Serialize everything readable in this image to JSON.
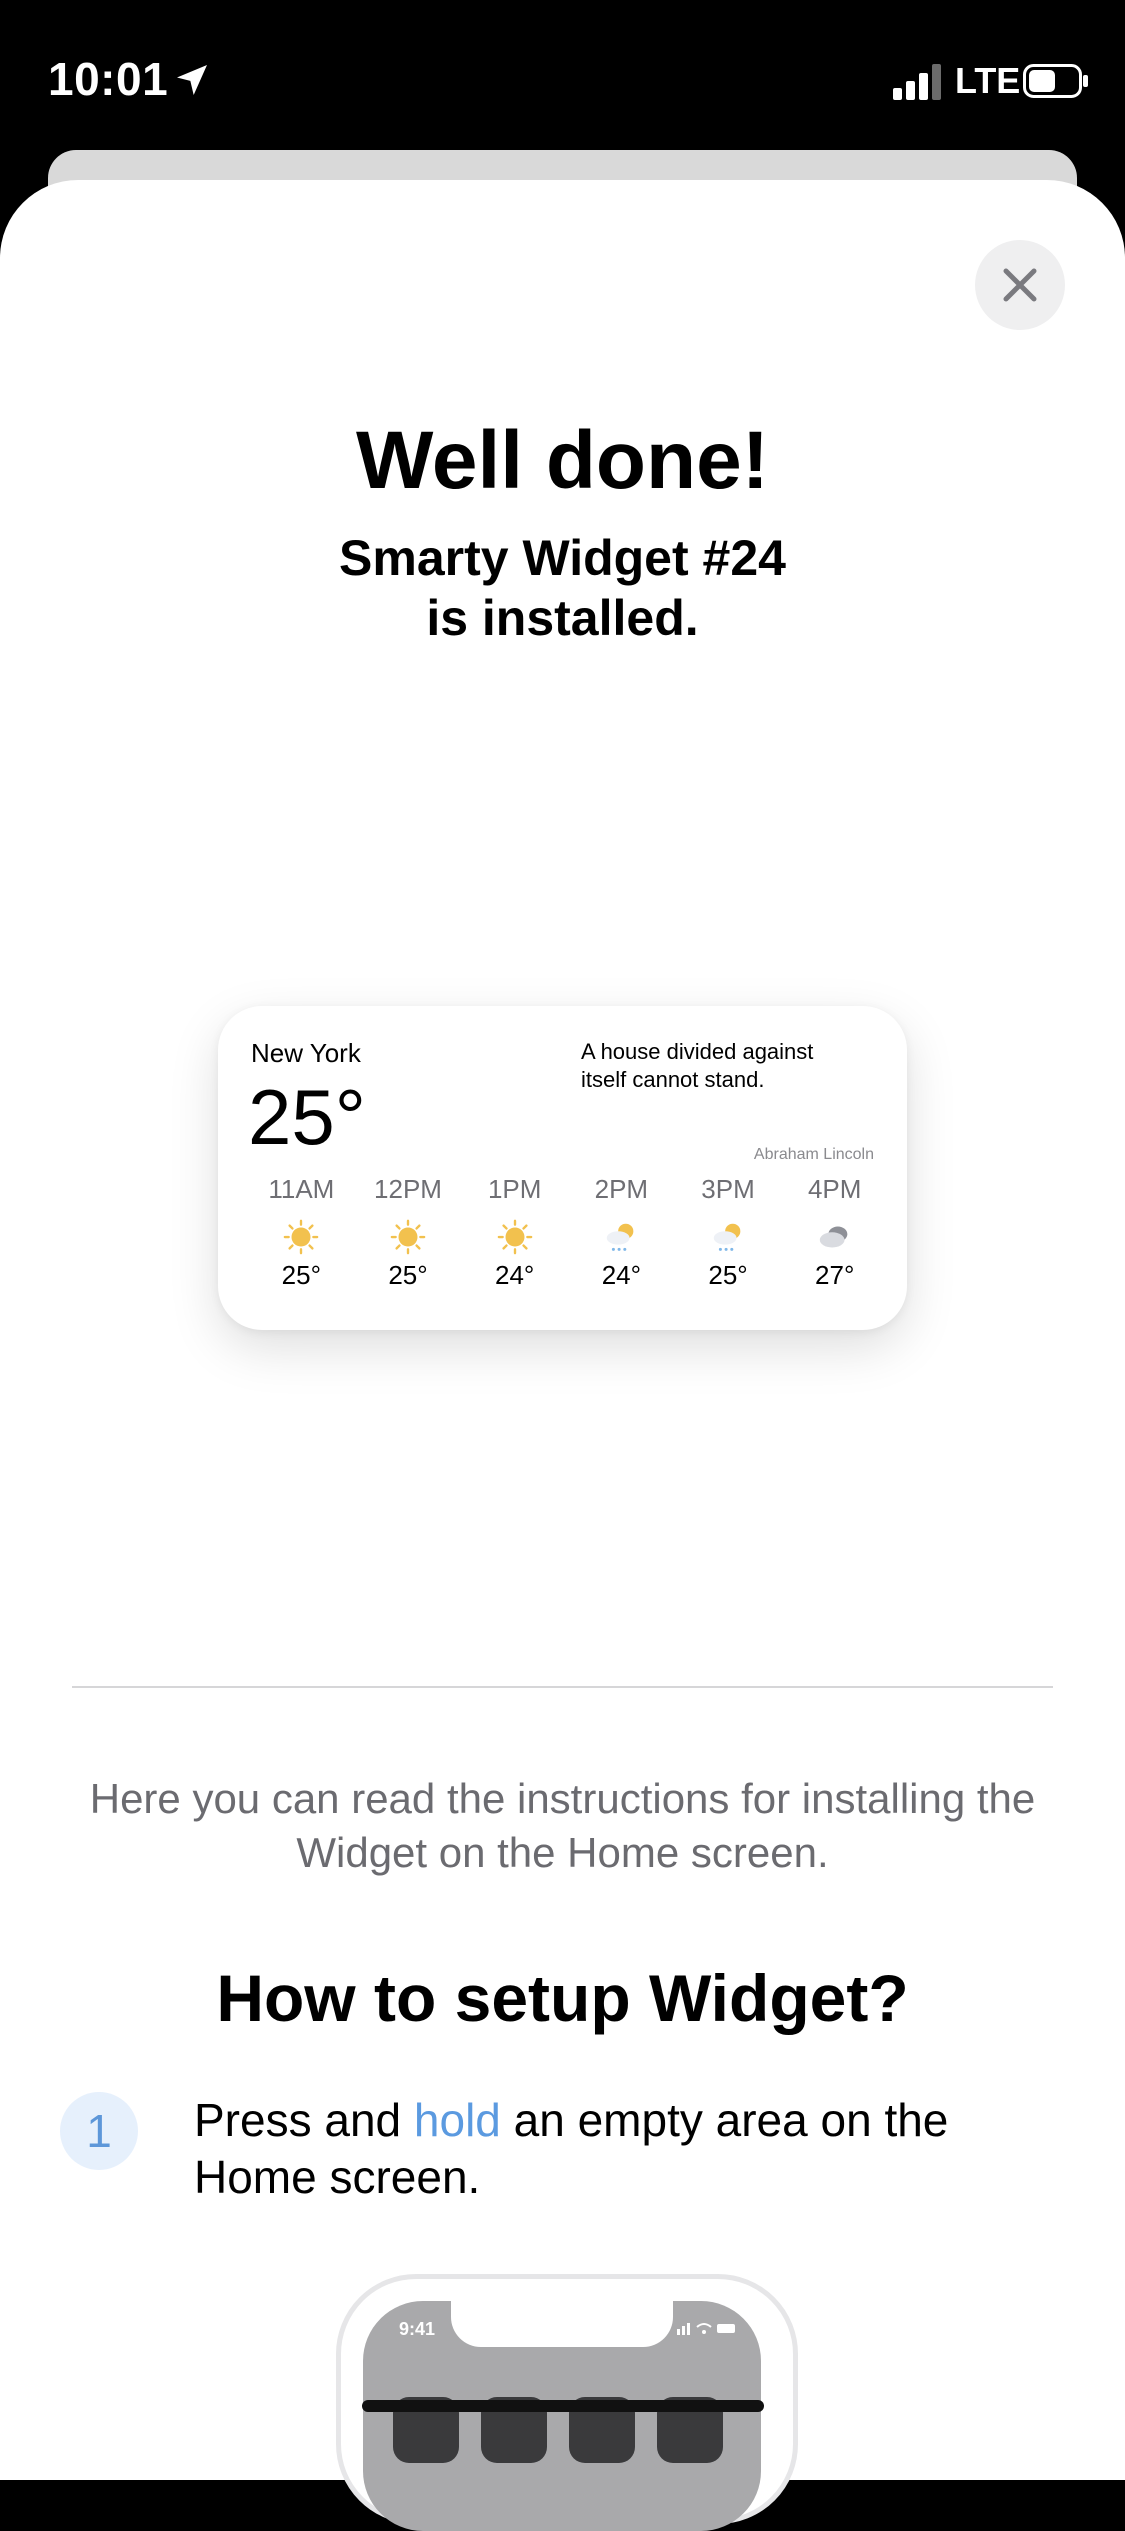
{
  "status_bar": {
    "time": "10:01",
    "network": "LTE",
    "icons": [
      "location-arrow-icon",
      "signal-icon",
      "battery-icon"
    ]
  },
  "sheet": {
    "close_icon": "close-icon",
    "title": "Well done!",
    "subtitle_line1": "Smarty Widget #24",
    "subtitle_line2": "is installed."
  },
  "widget": {
    "city": "New York",
    "temperature": "25°",
    "quote_line1": "A house divided against",
    "quote_line2": "itself cannot stand.",
    "author": "Abraham Lincoln",
    "hours": [
      {
        "time": "11AM",
        "icon": "sun-icon",
        "temp": "25°"
      },
      {
        "time": "12PM",
        "icon": "sun-icon",
        "temp": "25°"
      },
      {
        "time": "1PM",
        "icon": "sun-icon",
        "temp": "24°"
      },
      {
        "time": "2PM",
        "icon": "partly-cloudy-rain-icon",
        "temp": "24°"
      },
      {
        "time": "3PM",
        "icon": "partly-cloudy-rain-icon",
        "temp": "25°"
      },
      {
        "time": "4PM",
        "icon": "cloud-icon",
        "temp": "27°"
      }
    ]
  },
  "instructions": {
    "text": "Here you can read the instructions for installing the Widget on the Home screen.",
    "heading": "How to setup Widget?",
    "steps": [
      {
        "number": "1",
        "text_before": "Press and",
        "highlight": "hold",
        "text_after": "an empty area on the Home screen."
      }
    ]
  },
  "illustration": {
    "phone_time": "9:41"
  },
  "colors": {
    "accent": "#5b9ae0",
    "sun": "#f2c14e",
    "badge_bg": "#e6f0fc"
  }
}
